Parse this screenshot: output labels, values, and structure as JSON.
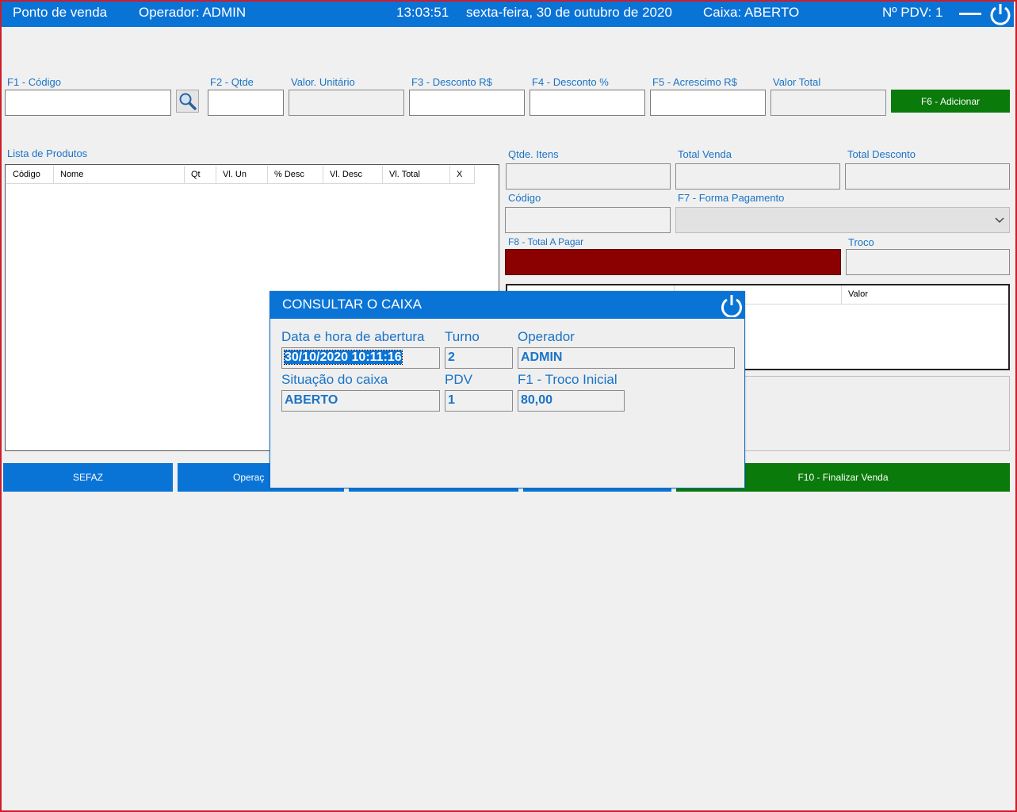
{
  "header": {
    "app_title": "Ponto de venda",
    "operator": "Operador: ADMIN",
    "time": "13:03:51",
    "date": "sexta-feira, 30 de outubro de 2020",
    "cash_status": "Caixa: ABERTO",
    "pdv_number": "Nº PDV: 1"
  },
  "product_entry": {
    "code_label": "F1 - Código",
    "qty_label": "F2 - Qtde",
    "unit_value_label": "Valor. Unitário",
    "discount_value_label": "F3 - Desconto R$",
    "discount_pct_label": "F4 - Desconto  %",
    "surcharge_label": "F5 - Acrescimo R$",
    "total_value_label": "Valor Total",
    "add_button": "F6 - Adicionar"
  },
  "product_list": {
    "label": "Lista de Produtos",
    "columns": [
      "Código",
      "Nome",
      "Qt",
      "Vl. Un",
      "% Desc",
      "Vl. Desc",
      "Vl. Total",
      "X"
    ]
  },
  "summary": {
    "items_qty_label": "Qtde. Itens",
    "total_sale_label": "Total Venda",
    "total_discount_label": "Total Desconto",
    "code_label": "Código",
    "payment_method_label": "F7 - Forma Pagamento",
    "total_to_pay_label": "F8 - Total A Pagar",
    "change_label": "Troco",
    "payments_value_column": "Valor"
  },
  "bottom_buttons": {
    "sefaz": "SEFAZ",
    "operations": "Operaç",
    "finalize": "F10 - Finalizar Venda"
  },
  "dialog": {
    "title": "CONSULTAR O CAIXA",
    "open_datetime_label": "Data e hora de abertura",
    "open_datetime_value": "30/10/2020 10:11:16",
    "shift_label": "Turno",
    "shift_value": "2",
    "operator_label": "Operador",
    "operator_value": "ADMIN",
    "status_label": "Situação do caixa",
    "status_value": "ABERTO",
    "pdv_label": "PDV",
    "pdv_value": "1",
    "initial_change_label": "F1 - Troco Inicial",
    "initial_change_value": "80,00"
  },
  "colors": {
    "primary": "#0a74d6",
    "success": "#0a7a0a",
    "total_to_pay": "#8b0000",
    "border_accent": "#d01c2a"
  }
}
